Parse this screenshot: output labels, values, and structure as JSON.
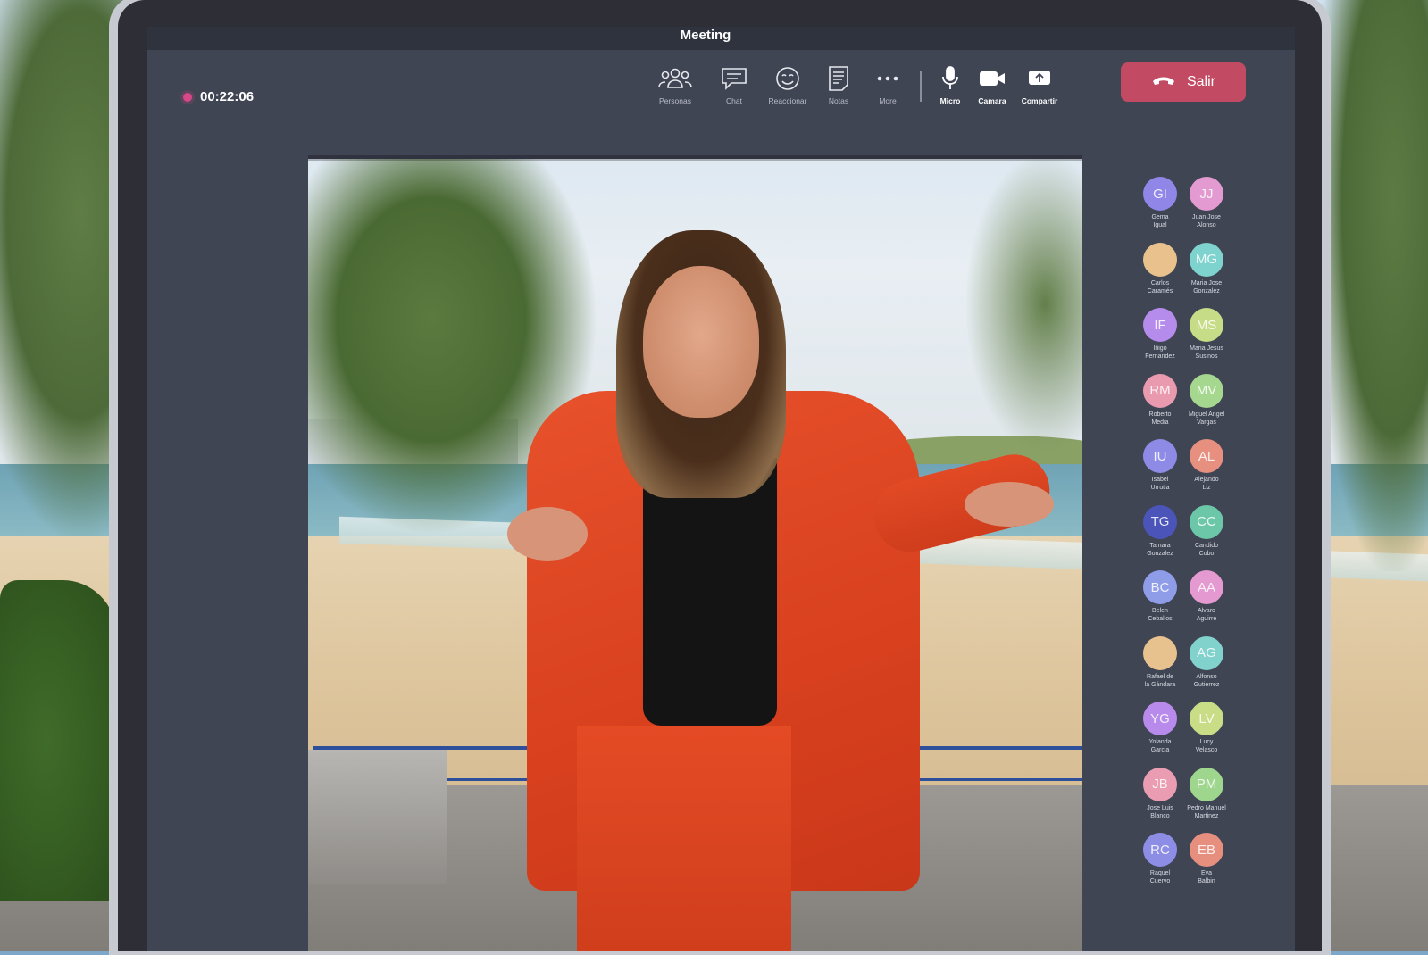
{
  "window": {
    "title": "Meeting"
  },
  "recording": {
    "time": "00:22:06"
  },
  "toolbar": {
    "items": [
      {
        "label": "Personas",
        "icon": "people-icon"
      },
      {
        "label": "Chat",
        "icon": "chat-icon"
      },
      {
        "label": "Reaccionar",
        "icon": "smiley-icon"
      },
      {
        "label": "Notas",
        "icon": "notes-icon"
      },
      {
        "label": "More",
        "icon": "more-icon"
      },
      {
        "label": "Micro",
        "icon": "microphone-icon"
      },
      {
        "label": "Camara",
        "icon": "camera-icon"
      },
      {
        "label": "Compartir",
        "icon": "share-icon"
      }
    ],
    "leave_label": "Salir"
  },
  "participants": [
    {
      "initials": "GI",
      "line1": "Gema",
      "line2": "Igual",
      "color": "#8f86e8"
    },
    {
      "initials": "JJ",
      "line1": "Juan Jose",
      "line2": "Alonso",
      "color": "#e39ad0"
    },
    {
      "initials": "",
      "line1": "Carlos",
      "line2": "Caramés",
      "color": "#e8c18d"
    },
    {
      "initials": "MG",
      "line1": "Maria Jose",
      "line2": "Gonzalez",
      "color": "#7fd3cf"
    },
    {
      "initials": "IF",
      "line1": "Iñigo",
      "line2": "Fernandez",
      "color": "#b58bec"
    },
    {
      "initials": "MS",
      "line1": "Maria Jesus",
      "line2": "Susinos",
      "color": "#c7dc86"
    },
    {
      "initials": "RM",
      "line1": "Roberto",
      "line2": "Media",
      "color": "#e99aae"
    },
    {
      "initials": "MV",
      "line1": "Miguel Angel",
      "line2": "Vargas",
      "color": "#a6d78f"
    },
    {
      "initials": "IU",
      "line1": "Isabel",
      "line2": "Urrutia",
      "color": "#8e8be6"
    },
    {
      "initials": "AL",
      "line1": "Alejando",
      "line2": "Liz",
      "color": "#e7907f"
    },
    {
      "initials": "TG",
      "line1": "Tamara",
      "line2": "Gonzalez",
      "color": "#4b54b8"
    },
    {
      "initials": "CC",
      "line1": "Candido",
      "line2": "Cobo",
      "color": "#6cc7a8"
    },
    {
      "initials": "BC",
      "line1": "Belen",
      "line2": "Ceballos",
      "color": "#8f9de9"
    },
    {
      "initials": "AA",
      "line1": "Alvaro",
      "line2": "Aguirre",
      "color": "#e49ad0"
    },
    {
      "initials": "",
      "line1": "Rafael de",
      "line2": "la Gándara",
      "color": "#e7c28f"
    },
    {
      "initials": "AG",
      "line1": "Alfonso",
      "line2": "Gutierrez",
      "color": "#81d2cd"
    },
    {
      "initials": "YG",
      "line1": "Yolanda",
      "line2": "Garcia",
      "color": "#b88aec"
    },
    {
      "initials": "LV",
      "line1": "Lucy",
      "line2": "Velasco",
      "color": "#c8dd86"
    },
    {
      "initials": "JB",
      "line1": "Jose Luis",
      "line2": "Blanco",
      "color": "#e99cb2"
    },
    {
      "initials": "PM",
      "line1": "Pedro Manuel",
      "line2": "Martinez",
      "color": "#9fd68d"
    },
    {
      "initials": "RC",
      "line1": "Raquel",
      "line2": "Cuervo",
      "color": "#8d8de6"
    },
    {
      "initials": "EB",
      "line1": "Eva",
      "line2": "Balbin",
      "color": "#e78f7f"
    }
  ]
}
